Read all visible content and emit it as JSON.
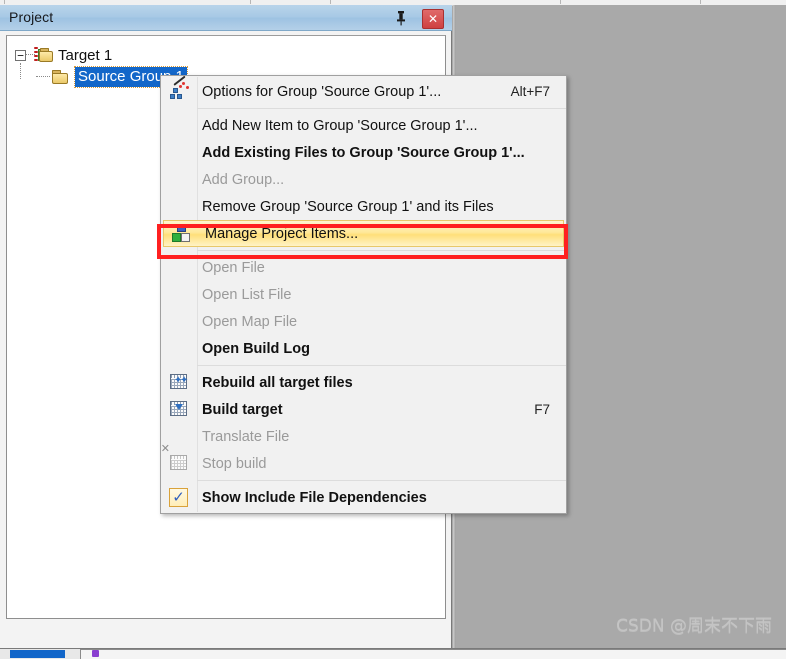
{
  "panel": {
    "title": "Project",
    "pin_icon": "pin-icon",
    "close_icon": "close-icon",
    "close_glyph": "✕"
  },
  "tree": {
    "nodes": [
      {
        "label": "Target 1",
        "icon": "target-folder-icon",
        "expander": "−",
        "selected": false
      },
      {
        "label": "Source Group 1",
        "icon": "folder-icon",
        "expander": "",
        "selected": true
      }
    ]
  },
  "context_menu": {
    "items": [
      {
        "label": "Options for Group 'Source Group 1'...",
        "accel": "Alt+F7",
        "icon": "options-wand-icon",
        "disabled": false,
        "bold": false,
        "highlighted": false
      },
      {
        "separator": true
      },
      {
        "label": "Add New  Item to Group 'Source Group 1'...",
        "accel": "",
        "icon": "",
        "disabled": false,
        "bold": false,
        "highlighted": false
      },
      {
        "label": "Add Existing Files to Group 'Source Group 1'...",
        "accel": "",
        "icon": "",
        "disabled": false,
        "bold": true,
        "highlighted": false
      },
      {
        "label": "Add Group...",
        "accel": "",
        "icon": "",
        "disabled": true,
        "bold": false,
        "highlighted": false
      },
      {
        "label": "Remove Group 'Source Group 1' and its Files",
        "accel": "",
        "icon": "",
        "disabled": false,
        "bold": false,
        "highlighted": false
      },
      {
        "label": "Manage Project Items...",
        "accel": "",
        "icon": "manage-project-items-icon",
        "disabled": false,
        "bold": false,
        "highlighted": true
      },
      {
        "separator": true
      },
      {
        "label": "Open File",
        "accel": "",
        "icon": "",
        "disabled": true,
        "bold": false,
        "highlighted": false
      },
      {
        "label": "Open List File",
        "accel": "",
        "icon": "",
        "disabled": true,
        "bold": false,
        "highlighted": false
      },
      {
        "label": "Open Map File",
        "accel": "",
        "icon": "",
        "disabled": true,
        "bold": false,
        "highlighted": false
      },
      {
        "label": "Open Build Log",
        "accel": "",
        "icon": "",
        "disabled": false,
        "bold": true,
        "highlighted": false
      },
      {
        "separator": true
      },
      {
        "label": "Rebuild all target files",
        "accel": "",
        "icon": "rebuild-icon",
        "disabled": false,
        "bold": true,
        "highlighted": false
      },
      {
        "label": "Build target",
        "accel": "F7",
        "icon": "build-icon",
        "disabled": false,
        "bold": true,
        "highlighted": false
      },
      {
        "label": "Translate File",
        "accel": "",
        "icon": "",
        "disabled": true,
        "bold": false,
        "highlighted": false
      },
      {
        "label": "Stop build",
        "accel": "",
        "icon": "stop-build-icon",
        "disabled": true,
        "bold": false,
        "highlighted": false
      },
      {
        "separator": true
      },
      {
        "label": "Show Include File Dependencies",
        "accel": "",
        "icon": "checkbox-checked-icon",
        "disabled": false,
        "bold": true,
        "highlighted": false
      }
    ]
  },
  "annotation": {
    "highlight_color": "#ff2020",
    "target_item": "Manage Project Items..."
  },
  "watermark": {
    "text": "CSDN @周末不下雨"
  }
}
